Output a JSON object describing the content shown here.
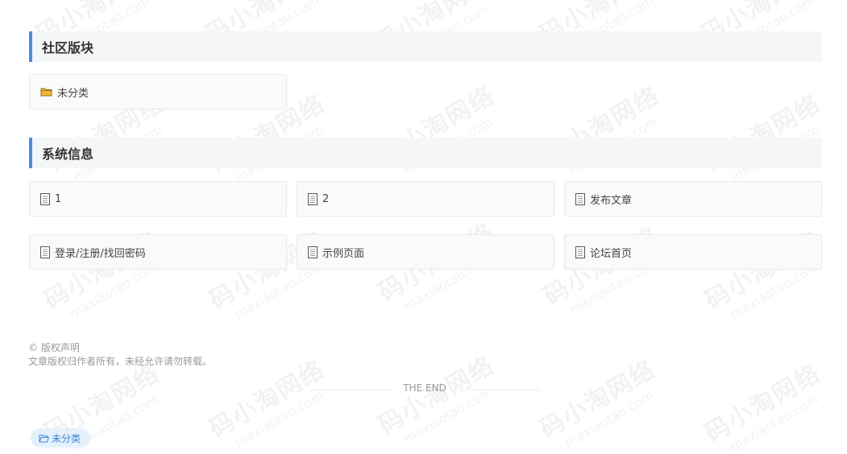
{
  "watermark": {
    "cn": "码小淘网络",
    "en": "maxiaotao.com"
  },
  "community": {
    "title": "社区版块",
    "items": [
      {
        "label": "未分类",
        "icon": "folder-icon"
      }
    ]
  },
  "system": {
    "title": "系统信息",
    "items": [
      {
        "label": "1",
        "icon": "document-icon"
      },
      {
        "label": "2",
        "icon": "document-icon"
      },
      {
        "label": "发布文章",
        "icon": "document-icon"
      },
      {
        "label": "登录/注册/找回密码",
        "icon": "document-icon"
      },
      {
        "label": "示例页面",
        "icon": "document-icon"
      },
      {
        "label": "论坛首页",
        "icon": "document-icon"
      }
    ]
  },
  "copyright": {
    "title": "© 版权声明",
    "text": "文章版权归作者所有，未经允许请勿转载。"
  },
  "end_text": "THE END",
  "tag": {
    "label": "未分类",
    "icon": "folder-open-icon"
  },
  "colors": {
    "accent": "#4a8be0",
    "section_bg": "#f5f6f8",
    "folder": "#f0b93b",
    "tag_bg": "#e4f0fb",
    "tag_text": "#3d87d8"
  }
}
